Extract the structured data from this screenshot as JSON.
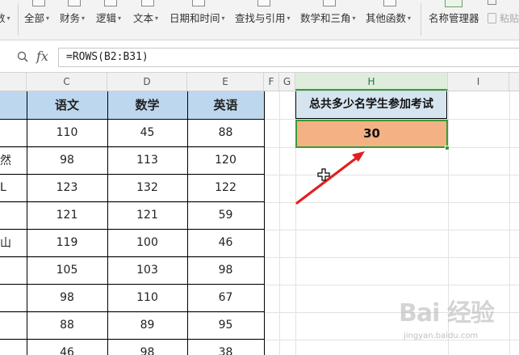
{
  "ribbon": {
    "items": [
      {
        "label": "数",
        "caret": "▾"
      },
      {
        "label": "全部",
        "caret": "▾"
      },
      {
        "label": "财务",
        "caret": "▾"
      },
      {
        "label": "逻辑",
        "caret": "▾"
      },
      {
        "label": "文本",
        "caret": "▾"
      },
      {
        "label": "日期和时间",
        "caret": "▾"
      },
      {
        "label": "查找与引用",
        "caret": "▾"
      },
      {
        "label": "数学和三角",
        "caret": "▾"
      },
      {
        "label": "其他函数",
        "caret": "▾"
      }
    ],
    "name_manager_label": "名称管理器",
    "paste_label": "粘贴"
  },
  "formula_bar": {
    "fx_label": "fx",
    "formula": "=ROWS(B2:B31)"
  },
  "columns": [
    "C",
    "D",
    "E",
    "F",
    "G",
    "H",
    "I"
  ],
  "table": {
    "headers": [
      "语文",
      "数学",
      "英语"
    ],
    "rows": [
      {
        "name": "",
        "values": [
          "110",
          "45",
          "88"
        ]
      },
      {
        "name": "然",
        "values": [
          "98",
          "113",
          "120"
        ]
      },
      {
        "name": "L",
        "values": [
          "123",
          "132",
          "122"
        ]
      },
      {
        "name": "",
        "values": [
          "121",
          "121",
          "59"
        ]
      },
      {
        "name": "山",
        "values": [
          "119",
          "100",
          "46"
        ]
      },
      {
        "name": "",
        "values": [
          "105",
          "103",
          "98"
        ]
      },
      {
        "name": "",
        "values": [
          "98",
          "110",
          "67"
        ]
      },
      {
        "name": "",
        "values": [
          "88",
          "89",
          "95"
        ]
      },
      {
        "name": "",
        "values": [
          "46",
          "98",
          "38"
        ]
      }
    ]
  },
  "result": {
    "header": "总共多少名学生参加考试",
    "value": "30"
  },
  "watermark": {
    "text": "Bai 经验",
    "url": "jingyan.baidu.com"
  },
  "colors": {
    "header_fill": "#bdd7ee",
    "result_header_fill": "#d6e4f0",
    "result_fill": "#f4b183",
    "selection_border": "#3a9a3a",
    "arrow": "#e02020"
  }
}
